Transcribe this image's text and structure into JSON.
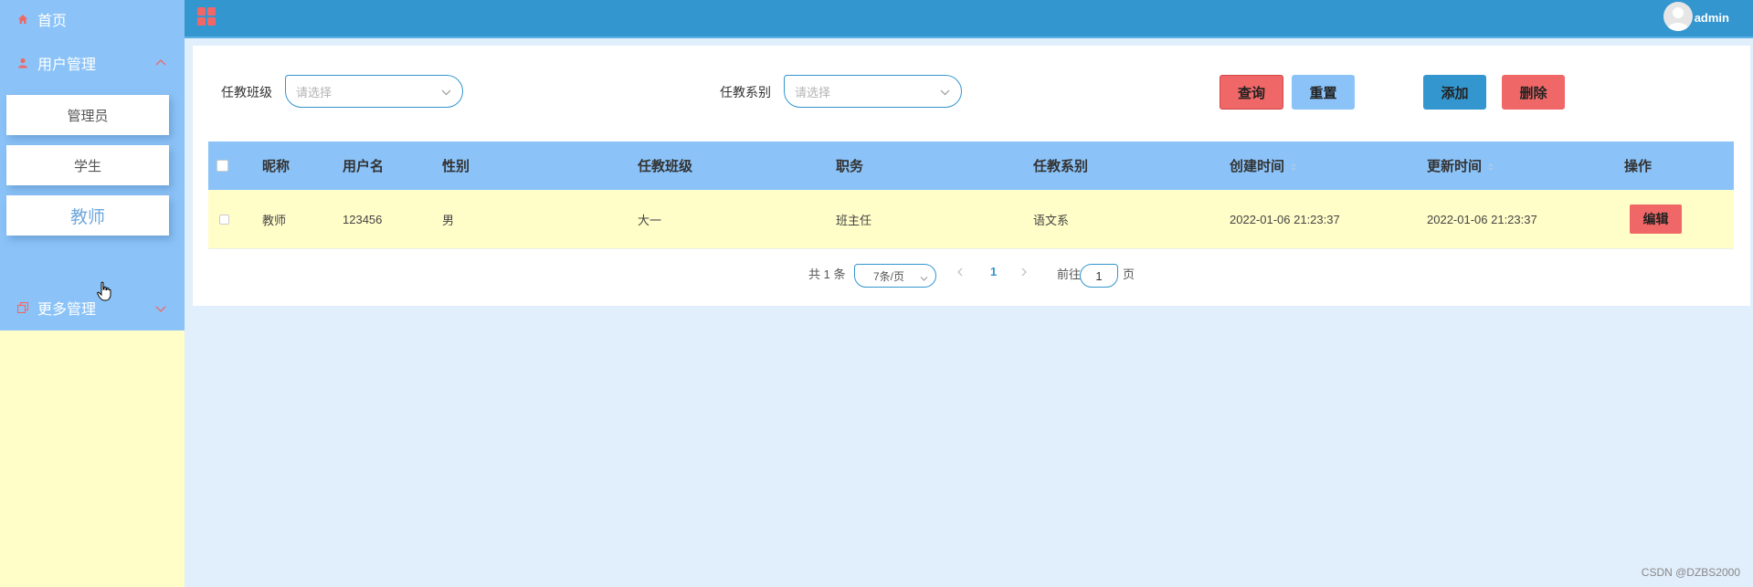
{
  "sidebar": {
    "home_label": "首页",
    "user_mgmt_label": "用户管理",
    "sub_items": [
      "管理员",
      "学生",
      "教师"
    ],
    "more_mgmt_label": "更多管理"
  },
  "header": {
    "username": "admin"
  },
  "filters": {
    "class_label": "任教班级",
    "class_placeholder": "请选择",
    "dept_label": "任教系别",
    "dept_placeholder": "请选择"
  },
  "buttons": {
    "query": "查询",
    "reset": "重置",
    "add": "添加",
    "delete": "删除"
  },
  "table": {
    "headers": [
      "昵称",
      "用户名",
      "性别",
      "任教班级",
      "职务",
      "任教系别",
      "创建时间",
      "更新时间",
      "操作"
    ],
    "rows": [
      [
        "教师",
        "123456",
        "男",
        "大一",
        "班主任",
        "语文系",
        "2022-01-06 21:23:37",
        "2022-01-06 21:23:37"
      ]
    ],
    "edit_label": "编辑"
  },
  "pagination": {
    "total": "共 1 条",
    "page_size": "7条/页",
    "current_page": "1",
    "goto_label": "前往",
    "goto_value": "1",
    "page_suffix": "页"
  },
  "watermark": "CSDN @DZBS2000",
  "colors": {
    "accent_blue": "#3396cf",
    "light_blue": "#8bc3f8",
    "red": "#f06767",
    "cream": "#fffdc8",
    "background": "#e1eefb"
  }
}
